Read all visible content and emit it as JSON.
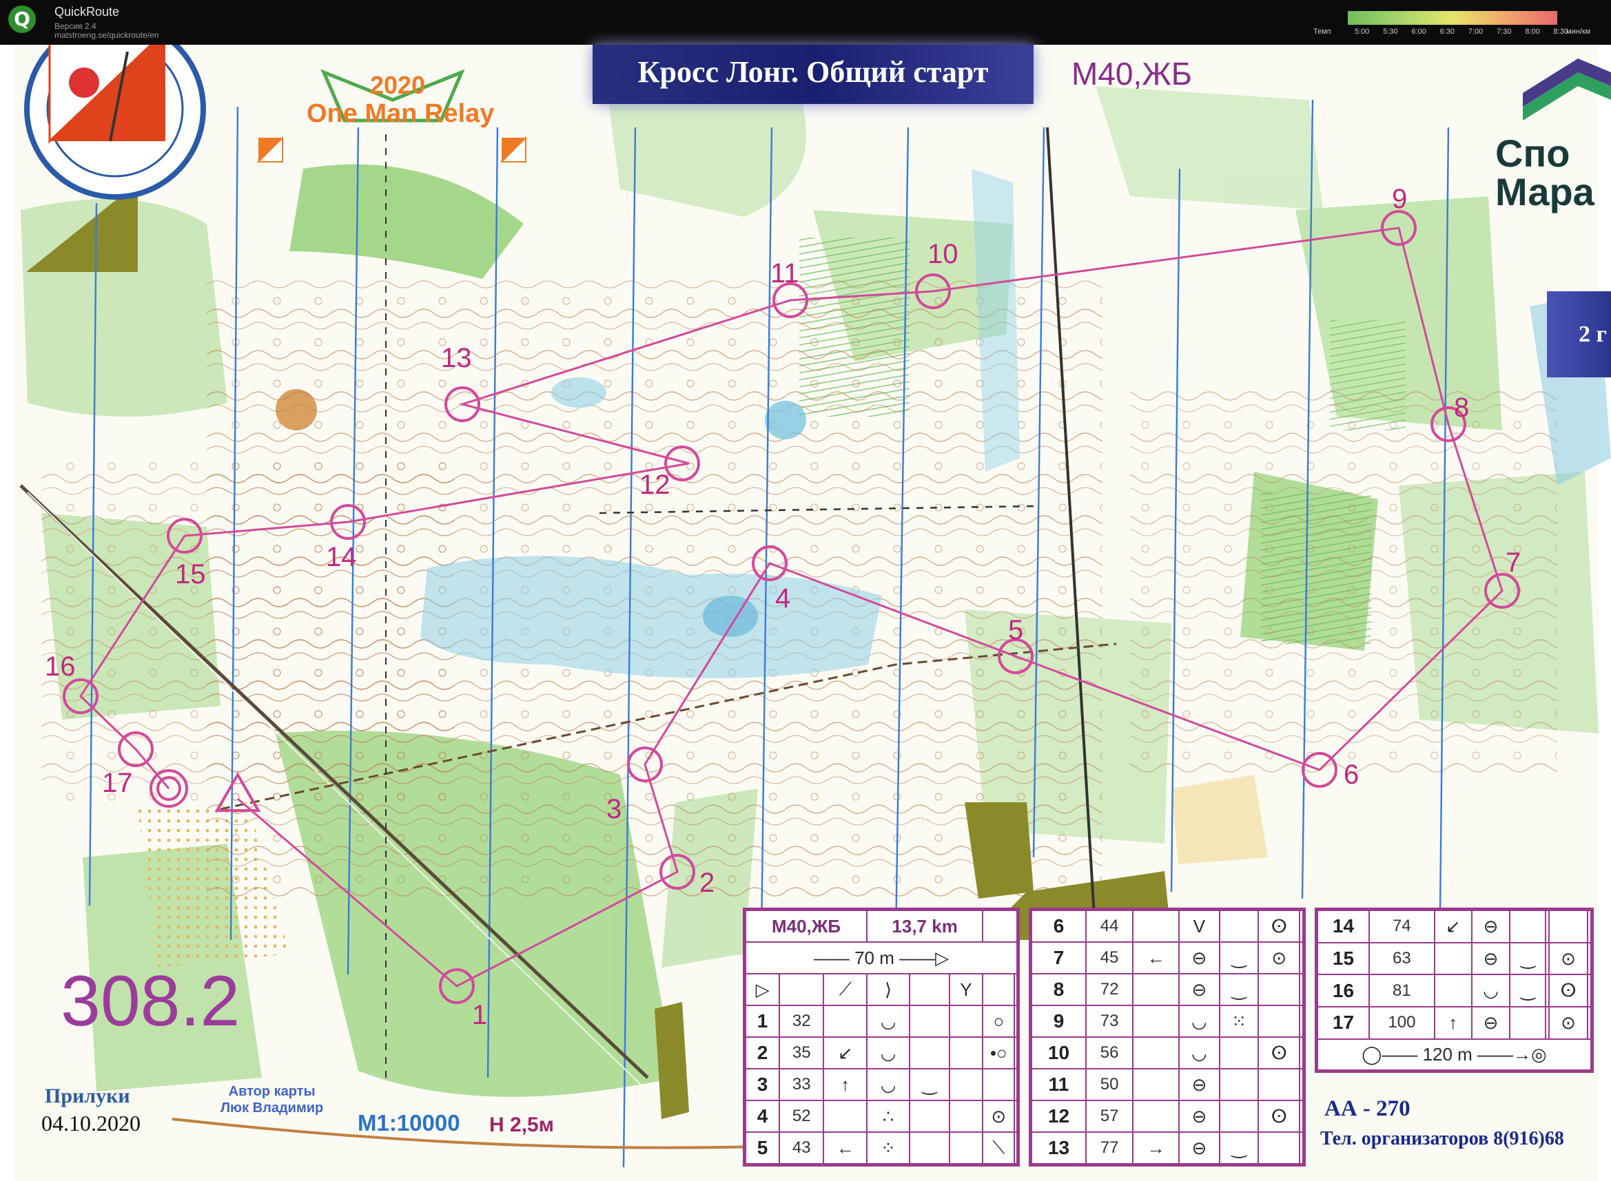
{
  "app": {
    "title": "QuickRoute",
    "version": "Версия 2.4",
    "url": "matstroeng.se/quickroute/en",
    "pace_label": "Темп",
    "pace_ticks": [
      "5:00",
      "5:30",
      "6:00",
      "6:30",
      "7:00",
      "7:30",
      "8:00",
      "8:30"
    ],
    "pace_unit": "мин/км"
  },
  "map": {
    "banner": "Кросс Лонг. Общий старт",
    "class_label": "М40,ЖБ",
    "relay_year": "2020",
    "relay_name": "One Man Relay",
    "sponsor": "Спо\nМара",
    "right_tag": "2 г",
    "big_number": "308.2",
    "place": "Прилуки",
    "date": "04.10.2020",
    "author": "Автор карты\nЛюк Владимир",
    "scale": "М1:10000",
    "height": "Н 2,5м",
    "aa": "АА - 270",
    "phone": "Тел. организаторов 8(916)68",
    "controls": [
      {
        "label": "1"
      },
      {
        "label": "2"
      },
      {
        "label": "3"
      },
      {
        "label": "4"
      },
      {
        "label": "5"
      },
      {
        "label": "6"
      },
      {
        "label": "7"
      },
      {
        "label": "8"
      },
      {
        "label": "9"
      },
      {
        "label": "10"
      },
      {
        "label": "11"
      },
      {
        "label": "12"
      },
      {
        "label": "13"
      },
      {
        "label": "14"
      },
      {
        "label": "15"
      },
      {
        "label": "16"
      },
      {
        "label": "17"
      }
    ]
  },
  "description": {
    "class": "М40,ЖБ",
    "length": "13,7 km",
    "start_leg": "70 m",
    "finish_leg": "120 m",
    "table1": [
      {
        "num": "1",
        "code": "32",
        "d": "",
        "e": "◡",
        "f": "",
        "g": "",
        "h": "○"
      },
      {
        "num": "2",
        "code": "35",
        "d": "↙",
        "e": "◡",
        "f": "",
        "g": "",
        "h": "•○"
      },
      {
        "num": "3",
        "code": "33",
        "d": "↑",
        "e": "◡",
        "f": "‿",
        "g": "",
        "h": ""
      },
      {
        "num": "4",
        "code": "52",
        "d": "",
        "e": "∴",
        "f": "",
        "g": "",
        "h": "⊙"
      },
      {
        "num": "5",
        "code": "43",
        "d": "←",
        "e": "⁘",
        "f": "",
        "g": "",
        "h": "⟍"
      }
    ],
    "table2": [
      {
        "num": "6",
        "code": "44",
        "d": "",
        "e": "V",
        "f": "",
        "g": "ⵙ",
        "h": ""
      },
      {
        "num": "7",
        "code": "45",
        "d": "←",
        "e": "⊖",
        "f": "‿",
        "g": "⊙",
        "h": ""
      },
      {
        "num": "8",
        "code": "72",
        "d": "",
        "e": "⊖",
        "f": "‿",
        "g": "",
        "h": ""
      },
      {
        "num": "9",
        "code": "73",
        "d": "",
        "e": "◡",
        "f": "⁙",
        "g": "",
        "h": ""
      },
      {
        "num": "10",
        "code": "56",
        "d": "",
        "e": "◡",
        "f": "",
        "g": "ⵙ",
        "h": ""
      },
      {
        "num": "11",
        "code": "50",
        "d": "",
        "e": "⊖",
        "f": "",
        "g": "",
        "h": ""
      },
      {
        "num": "12",
        "code": "57",
        "d": "",
        "e": "⊖",
        "f": "",
        "g": "ⵙ",
        "h": ""
      },
      {
        "num": "13",
        "code": "77",
        "d": "→",
        "e": "⊖",
        "f": "‿",
        "g": "",
        "h": ""
      }
    ],
    "table3": [
      {
        "num": "14",
        "code": "74",
        "d": "↙",
        "e": "⊖",
        "f": "",
        "g": "",
        "h": ""
      },
      {
        "num": "15",
        "code": "63",
        "d": "",
        "e": "⊖",
        "f": "‿",
        "g": "",
        "h": "⊙"
      },
      {
        "num": "16",
        "code": "81",
        "d": "",
        "e": "◡",
        "f": "‿",
        "g": "",
        "h": "ⵙ"
      },
      {
        "num": "17",
        "code": "100",
        "d": "↑",
        "e": "⊖",
        "f": "",
        "g": "",
        "h": "⊙"
      }
    ]
  }
}
